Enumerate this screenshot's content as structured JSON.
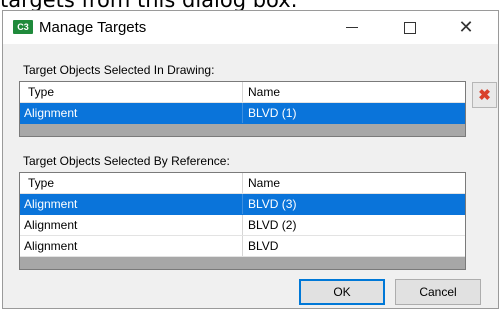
{
  "background_caption": "targets from this dialog box.",
  "window": {
    "title": "Manage Targets",
    "app_icon_text": "C3",
    "controls": {
      "minimize": "—",
      "maximize": "☐",
      "close": "✕"
    }
  },
  "drawing_section": {
    "label": "Target Objects Selected In Drawing:",
    "columns": [
      "Type",
      "Name"
    ],
    "rows": [
      {
        "type": "Alignment",
        "name": "BLVD (1)",
        "selected": true
      }
    ]
  },
  "reference_section": {
    "label": "Target Objects Selected By Reference:",
    "columns": [
      "Type",
      "Name"
    ],
    "rows": [
      {
        "type": "Alignment",
        "name": "BLVD (3)",
        "selected": true
      },
      {
        "type": "Alignment",
        "name": "BLVD (2)",
        "selected": false
      },
      {
        "type": "Alignment",
        "name": "BLVD",
        "selected": false
      }
    ]
  },
  "delete_button": {
    "glyph": "✖",
    "icon": "delete-icon",
    "color": "#d9412b"
  },
  "buttons": {
    "ok": "OK",
    "cancel": "Cancel"
  },
  "colors": {
    "selection": "#0a74da",
    "accent": "#0078d7"
  }
}
